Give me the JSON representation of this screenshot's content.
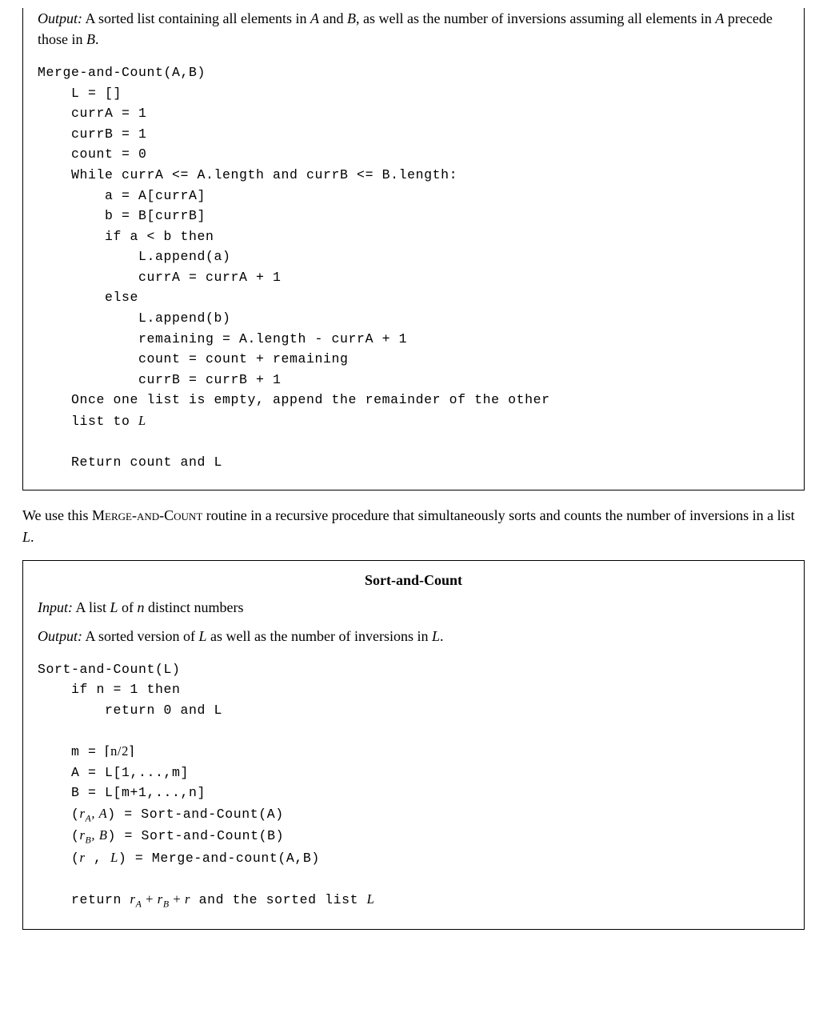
{
  "box1": {
    "output_label": "Output:",
    "output_text_1": " A sorted list containing all elements in ",
    "output_A": "A",
    "output_and": " and ",
    "output_B": "B",
    "output_text_2": ", as well as the number of inversions assuming all elements in ",
    "output_A2": "A",
    "output_text_3": " precede those in ",
    "output_B2": "B",
    "output_period": ".",
    "code": {
      "l1": "Merge-and-Count(A,B)",
      "l2": "    L = []",
      "l3": "    currA = 1",
      "l4": "    currB = 1",
      "l5": "    count = 0",
      "l6": "    While currA <= A.length and currB <= B.length:",
      "l7": "        a = A[currA]",
      "l8": "        b = B[currB]",
      "l9": "        if a < b then",
      "l10": "            L.append(a)",
      "l11": "            currA = currA + 1",
      "l12": "        else",
      "l13": "            L.append(b)",
      "l14": "            remaining = A.length - currA + 1",
      "l15": "            count = count + remaining",
      "l16": "            currB = currB + 1",
      "l17a": "    Once one list is empty, append the remainder of the other",
      "l17b": "    list to ",
      "l17L": "L",
      "l18": "    Return count and L"
    }
  },
  "midtext": {
    "t1": "We use this ",
    "smallcaps": "Merge-and-Count",
    "t2": " routine in a recursive procedure that simultaneously sorts and counts the number of inversions in a list ",
    "L": "L",
    "period": "."
  },
  "box2": {
    "title": "Sort-and-Count",
    "input_label": "Input:",
    "input_t1": " A list ",
    "input_L": "L",
    "input_t2": " of ",
    "input_n": "n",
    "input_t3": " distinct numbers",
    "output_label": "Output:",
    "output_t1": " A sorted version of ",
    "output_L": "L",
    "output_t2": " as well as the number of inversions in ",
    "output_L2": "L",
    "output_period": ".",
    "code": {
      "l1": "Sort-and-Count(L)",
      "l2": "    if n = 1 then",
      "l3": "        return 0 and L",
      "l4a": "    m = ",
      "l4b_open": "⌈",
      "l4b_inner": "n/2",
      "l4b_close": "⌉",
      "l5": "    A = L[1,...,m]",
      "l6": "    B = L[m+1,...,n]",
      "l7a": "    (",
      "l7_rA": "r",
      "l7_subA": "A",
      "l7b": ", ",
      "l7_A": "A",
      "l7c": ") = Sort-and-Count(A)",
      "l8a": "    (",
      "l8_rB": "r",
      "l8_subB": "B",
      "l8b": ", ",
      "l8_B": "B",
      "l8c": ") = Sort-and-Count(B)",
      "l9a": "    (",
      "l9_r": "r",
      "l9b": " , ",
      "l9_L": "L",
      "l9c": ") = Merge-and-count(A,B)",
      "l10a": "    return ",
      "l10_rA": "r",
      "l10_subA": "A",
      "l10_plus1": " + ",
      "l10_rB": "r",
      "l10_subB": "B",
      "l10_plus2": " + ",
      "l10_r": "r",
      "l10b": " and the sorted list ",
      "l10_L": "L"
    }
  }
}
